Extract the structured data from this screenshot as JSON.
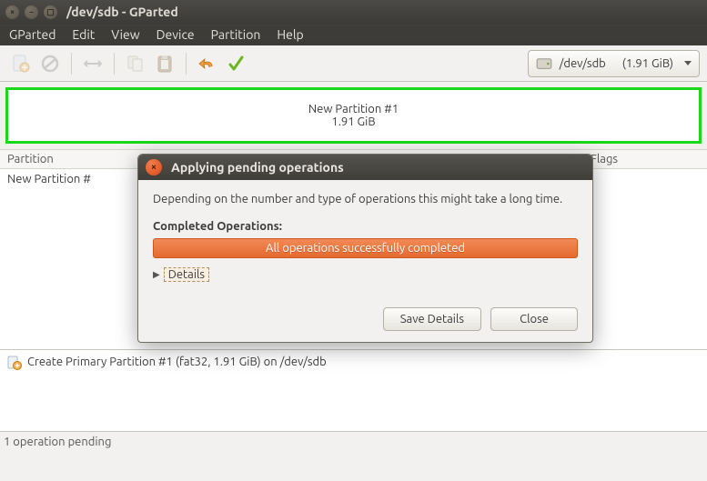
{
  "window": {
    "title": "/dev/sdb - GParted"
  },
  "menu": {
    "items": [
      "GParted",
      "Edit",
      "View",
      "Device",
      "Partition",
      "Help"
    ]
  },
  "device_selector": {
    "device": "/dev/sdb",
    "size": "(1.91 GiB)"
  },
  "partition_viz": {
    "name": "New Partition #1",
    "size": "1.91 GiB"
  },
  "columns": {
    "partition": "Partition",
    "flags": "Flags"
  },
  "list": {
    "row0": "New Partition #"
  },
  "operations": {
    "item0": "Create Primary Partition #1 (fat32, 1.91 GiB) on /dev/sdb"
  },
  "status": {
    "text": "1 operation pending"
  },
  "dialog": {
    "title": "Applying pending operations",
    "message": "Depending on the number and type of operations this might take a long time.",
    "completed_label": "Completed Operations:",
    "progress_text": "All operations successfully completed",
    "details_label": "Details",
    "save_btn": "Save Details",
    "close_btn": "Close"
  }
}
